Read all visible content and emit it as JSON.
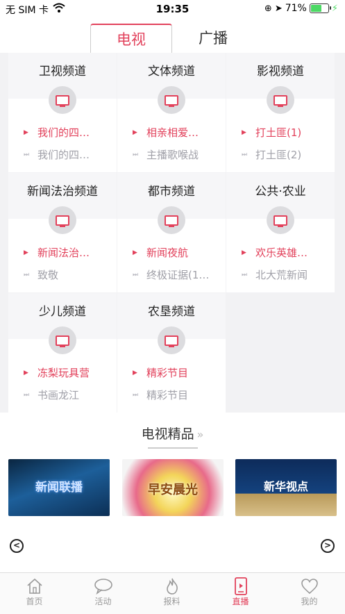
{
  "status": {
    "carrier": "无 SIM 卡",
    "time": "19:35",
    "battery_text": "71%",
    "battery_level": 0.71
  },
  "tabs": [
    {
      "label": "电视",
      "active": true
    },
    {
      "label": "广播",
      "active": false
    }
  ],
  "channels": [
    {
      "name": "卫视频道",
      "now": "我们的四…",
      "next": "我们的四…"
    },
    {
      "name": "文体频道",
      "now": "相亲相爱…",
      "next": "主播歌喉战"
    },
    {
      "name": "影视频道",
      "now": "打土匪(1)",
      "next": "打土匪(2)"
    },
    {
      "name": "新闻法治频道",
      "now": "新闻法治…",
      "next": "致敬"
    },
    {
      "name": "都市频道",
      "now": "新闻夜航",
      "next": "终极证据(1…"
    },
    {
      "name": "公共·农业",
      "now": "欢乐英雄…",
      "next": "北大荒新闻"
    },
    {
      "name": "少儿频道",
      "now": "冻梨玩具营",
      "next": "书画龙江"
    },
    {
      "name": "农垦频道",
      "now": "精彩节目",
      "next": "精彩节目"
    }
  ],
  "section": {
    "title": "电视精品",
    "more": "»"
  },
  "thumbs": [
    {
      "caption": "新闻联播"
    },
    {
      "caption": "早安晨光"
    },
    {
      "caption": "新华视点"
    }
  ],
  "nav": [
    {
      "label": "首页",
      "icon": "home-icon",
      "active": false
    },
    {
      "label": "活动",
      "icon": "chat-bubble-icon",
      "active": false
    },
    {
      "label": "报料",
      "icon": "flame-icon",
      "active": false
    },
    {
      "label": "直播",
      "icon": "phone-play-icon",
      "active": true
    },
    {
      "label": "我的",
      "icon": "heart-icon",
      "active": false
    }
  ],
  "colors": {
    "accent": "#e2415b",
    "muted": "#a0a0a8",
    "panel_bg": "#f2f2f4"
  }
}
